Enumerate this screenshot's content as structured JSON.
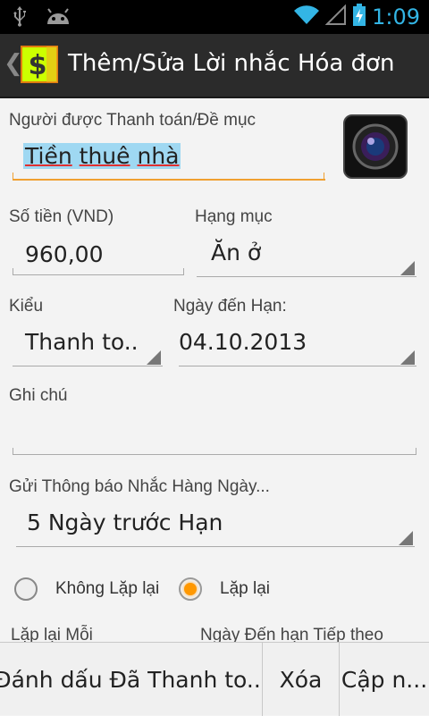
{
  "status_bar": {
    "time": "1:09",
    "icons": [
      "usb-icon",
      "android-debug-icon",
      "wifi-icon",
      "signal-icon",
      "battery-charging-icon"
    ]
  },
  "action_bar": {
    "title": "Thêm/Sửa Lời nhắc Hóa đơn",
    "logo_symbol": "$",
    "accent_color": "#ccff00"
  },
  "form": {
    "payee": {
      "label": "Người được Thanh toán/Đề mục",
      "value_words": [
        "Tiền",
        "thuê",
        "nhà"
      ]
    },
    "amount": {
      "label": "Số tiền (VND)",
      "value": "960,00"
    },
    "category": {
      "label": "Hạng mục",
      "value": "Ăn ở"
    },
    "type": {
      "label": "Kiểu",
      "value": "Thanh to.."
    },
    "due_date": {
      "label": "Ngày đến Hạn:",
      "value": "04.10.2013"
    },
    "notes": {
      "label": "Ghi chú",
      "value": ""
    },
    "notify": {
      "label": "Gửi Thông báo Nhắc Hàng Ngày...",
      "value": "5 Ngày trước Hạn"
    },
    "repeat": {
      "options": [
        {
          "label": "Không Lặp lại",
          "selected": false
        },
        {
          "label": "Lặp lại",
          "selected": true
        }
      ],
      "accent_color": "#ff9800"
    },
    "repeat_every": {
      "label": "Lặp lại Mỗi"
    },
    "next_due": {
      "label": "Ngày Đến hạn Tiếp theo"
    }
  },
  "bottom_bar": {
    "mark_paid_label": "Đánh dấu Đã Thanh to...",
    "delete_label": "Xóa",
    "update_label": "Cập n..."
  }
}
